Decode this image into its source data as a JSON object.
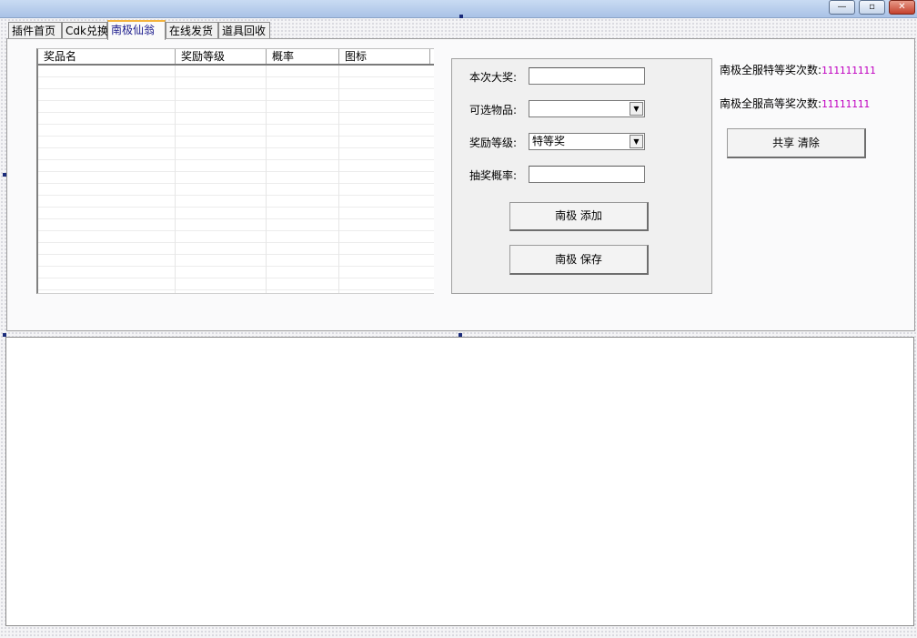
{
  "window": {
    "minimize_glyph": "—",
    "restore_glyph": "▫",
    "close_glyph": "✕"
  },
  "tabs": [
    {
      "label": "插件首页"
    },
    {
      "label": "Cdk兑换"
    },
    {
      "label": "南极仙翁",
      "active": true
    },
    {
      "label": "在线发货"
    },
    {
      "label": "道具回收"
    }
  ],
  "prize_table": {
    "columns": [
      "奖品名",
      "奖励等级",
      "概率",
      "图标"
    ],
    "rows": []
  },
  "form": {
    "grand_prize_label": "本次大奖:",
    "grand_prize_value": "",
    "items_label": "可选物品:",
    "items_value": "",
    "level_label": "奖励等级:",
    "level_value": "特等奖",
    "probability_label": "抽奖概率:",
    "probability_value": "",
    "add_button": "南极 添加",
    "save_button": "南极 保存"
  },
  "stats": {
    "special_label": "南极全服特等奖次数:",
    "special_value": "111111111",
    "high_label": "南极全服高等奖次数:",
    "high_value": "11111111",
    "clear_button": "共享 清除"
  },
  "colors": {
    "stat_value": "#c000c0",
    "active_tab_accent": "#f3b33d"
  }
}
